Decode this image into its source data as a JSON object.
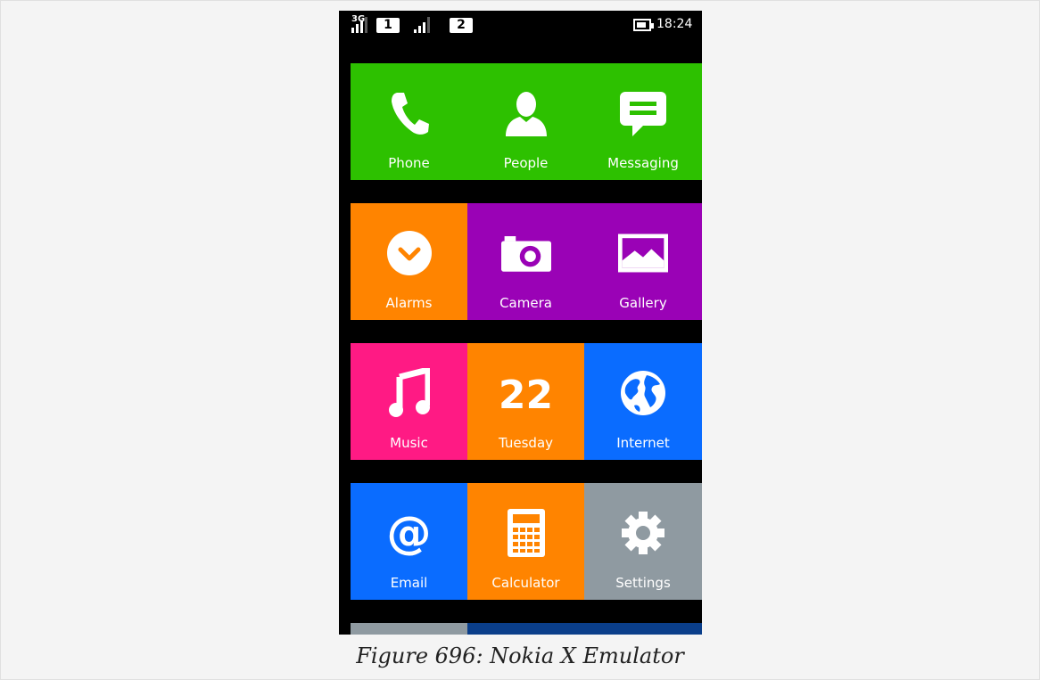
{
  "status_bar": {
    "network_type": "3G",
    "sim1": "1",
    "sim2": "2",
    "time": "18:24"
  },
  "tiles": {
    "phone": "Phone",
    "people": "People",
    "messaging": "Messaging",
    "alarms": "Alarms",
    "camera": "Camera",
    "gallery": "Gallery",
    "music": "Music",
    "calendar_day": "22",
    "calendar_weekday": "Tuesday",
    "internet": "Internet",
    "email": "Email",
    "calculator": "Calculator",
    "settings": "Settings"
  },
  "colors": {
    "green": "#2dc100",
    "orange": "#ff8400",
    "purple": "#9a02b6",
    "pink": "#ff1a84",
    "blue": "#0a6cff",
    "gray": "#8f9aa1",
    "dark_blue": "#0a3e8a"
  },
  "icons": {
    "phone": "phone-handset-icon",
    "people": "person-icon",
    "messaging": "chat-bubble-icon",
    "alarms": "alarm-clock-icon",
    "camera": "camera-icon",
    "gallery": "picture-icon",
    "music": "music-note-icon",
    "internet": "globe-icon",
    "email": "at-sign-icon",
    "calculator": "calculator-icon",
    "settings": "gear-icon"
  },
  "caption": "Figure 696: Nokia X Emulator"
}
